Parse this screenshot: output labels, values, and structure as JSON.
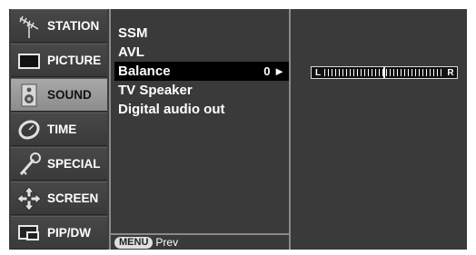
{
  "sidebar": {
    "items": [
      {
        "label": "STATION",
        "icon": "antenna-icon",
        "active": false
      },
      {
        "label": "PICTURE",
        "icon": "tv-screen-icon",
        "active": false
      },
      {
        "label": "SOUND",
        "icon": "speaker-icon",
        "active": true
      },
      {
        "label": "TIME",
        "icon": "clock-icon",
        "active": false
      },
      {
        "label": "SPECIAL",
        "icon": "key-icon",
        "active": false
      },
      {
        "label": "SCREEN",
        "icon": "move-arrows-icon",
        "active": false
      },
      {
        "label": "PIP/DW",
        "icon": "pip-window-icon",
        "active": false
      }
    ]
  },
  "submenu": {
    "items": [
      {
        "label": "SSM",
        "value": ""
      },
      {
        "label": "AVL",
        "value": ""
      },
      {
        "label": "Balance",
        "value": "0 ►",
        "selected": true
      },
      {
        "label": "TV Speaker",
        "value": ""
      },
      {
        "label": "Digital audio out",
        "value": ""
      }
    ],
    "footer": {
      "menu_key": "MENU",
      "prev_label": "Prev"
    }
  },
  "balance_slider": {
    "left_label": "L",
    "right_label": "R",
    "value": 0,
    "min": -50,
    "max": 50
  },
  "colors": {
    "panel_bg": "#3a3a3a",
    "selected_bg": "#000000",
    "active_tab": "#9a9a9a",
    "divider": "#8a8a8a"
  }
}
